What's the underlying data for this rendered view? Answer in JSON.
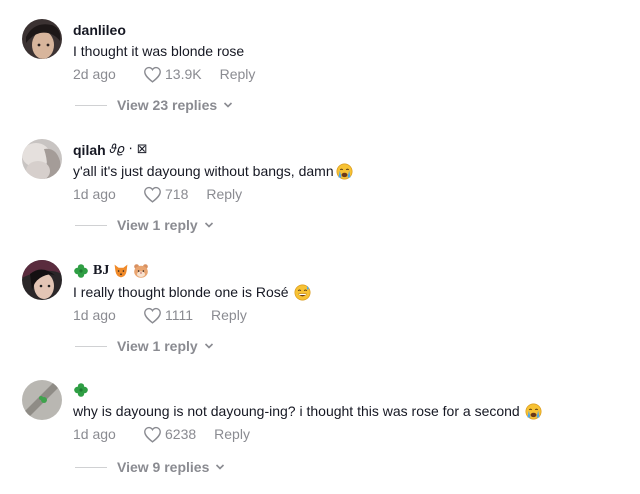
{
  "comments": [
    {
      "username": "danlileo",
      "username_extra": "",
      "text": "I thought it was blonde rose",
      "age": "2d ago",
      "likes": "13.9K",
      "reply_label": "Reply",
      "view_replies": "View 23 replies"
    },
    {
      "username": "qilah",
      "username_extra": "𝜗𝜚 ⋅ ⊠",
      "text": "y'all it's just dayoung without bangs, damn",
      "age": "1d ago",
      "likes": "718",
      "reply_label": "Reply",
      "view_replies": "View 1 reply"
    },
    {
      "username": "BJ",
      "username_extra": "",
      "text": "I really thought blonde one is Rosé",
      "age": "1d ago",
      "likes": "1111",
      "reply_label": "Reply",
      "view_replies": "View 1 reply"
    },
    {
      "username": "",
      "username_extra": "",
      "text": "why is dayoung is not dayoung-ing? i thought this was rose for a second",
      "age": "1d ago",
      "likes": "6238",
      "reply_label": "Reply",
      "view_replies": "View 9 replies"
    }
  ],
  "icons": {
    "heart": "heart-outline-icon",
    "chevron": "chevron-down-icon",
    "crying_emoji": "crying-face-emoji-icon",
    "sweat_smile_emoji": "sweat-smile-emoji-icon",
    "clover": "four-leaf-clover-icon",
    "fox": "fox-face-icon",
    "hamster": "hamster-face-icon"
  },
  "colors": {
    "text": "#161823",
    "muted": "#8a8b91",
    "divider": "#d0d1d3",
    "clover": "#2f9e44"
  }
}
